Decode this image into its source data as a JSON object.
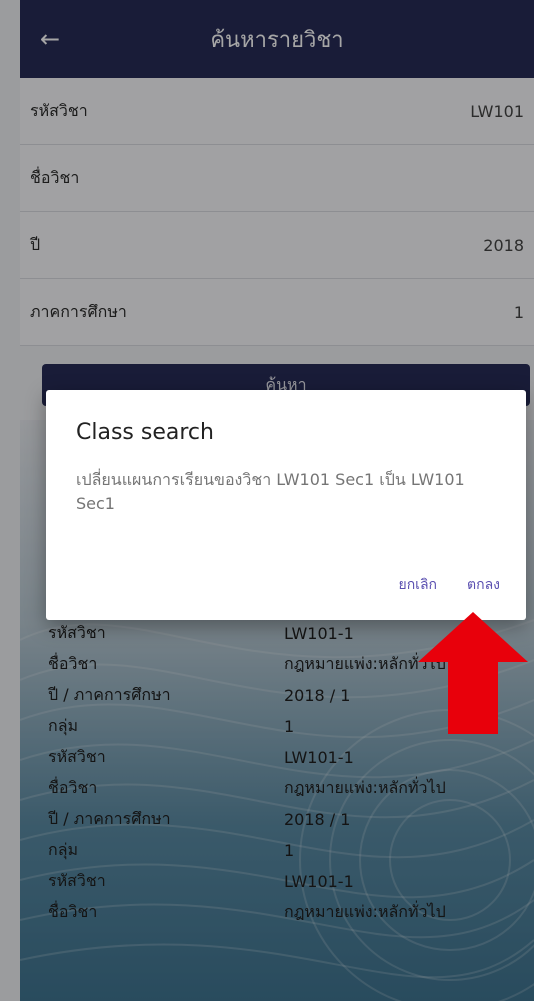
{
  "header": {
    "title": "ค้นหารายวิชา",
    "back_icon": "arrow-left-icon"
  },
  "form": {
    "rows": [
      {
        "label": "รหัสวิชา",
        "value": "LW101"
      },
      {
        "label": "ชื่อวิชา",
        "value": ""
      },
      {
        "label": "ปี",
        "value": "2018"
      },
      {
        "label": "ภาคการศึกษา",
        "value": "1"
      }
    ],
    "search_label": "ค้นหา"
  },
  "results": [
    {
      "label": "รหัสวิชา",
      "value": "LW101-1"
    },
    {
      "label": "ชื่อวิชา",
      "value": "กฎหมายแพ่ง:หลักทั่วไป"
    },
    {
      "label": "ปี / ภาคการศึกษา",
      "value": "2018 / 1"
    },
    {
      "label": "กลุ่ม",
      "value": "1"
    },
    {
      "label": "รหัสวิชา",
      "value": "LW101-1"
    },
    {
      "label": "ชื่อวิชา",
      "value": "กฎหมายแพ่ง:หลักทั่วไป"
    },
    {
      "label": "ปี / ภาคการศึกษา",
      "value": "2018 / 1"
    },
    {
      "label": "กลุ่ม",
      "value": "1"
    },
    {
      "label": "รหัสวิชา",
      "value": "LW101-1"
    },
    {
      "label": "ชื่อวิชา",
      "value": "กฎหมายแพ่ง:หลักทั่วไป"
    }
  ],
  "dialog": {
    "title": "Class search",
    "message": "เปลี่ยนแผนการเรียนของวิชา LW101 Sec1 เป็น LW101 Sec1",
    "cancel_label": "ยกเลิก",
    "ok_label": "ตกลง"
  },
  "colors": {
    "header": "#272c56",
    "accent": "#5a4fb0",
    "arrow": "#e8000b"
  }
}
